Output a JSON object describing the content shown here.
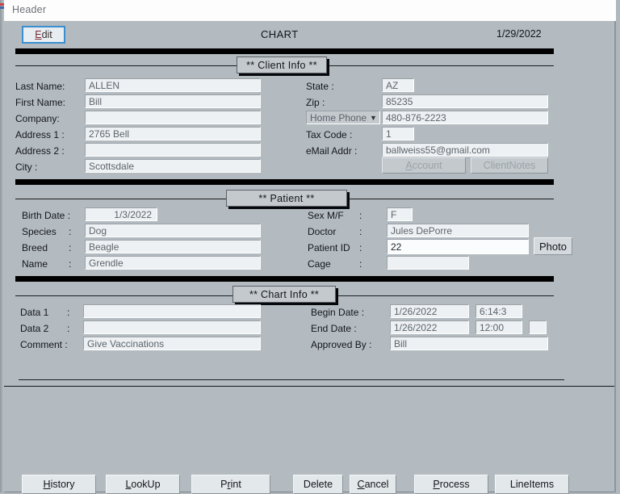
{
  "window": {
    "title": "Header"
  },
  "toolbar": {
    "edit_label": "Edit",
    "edit_accel": "E",
    "chart_title": "CHART",
    "date": "1/29/2022"
  },
  "sections": {
    "client": {
      "chip": "**  Client Info  **"
    },
    "patient": {
      "chip": "**  Patient  **"
    },
    "chartinfo": {
      "chip": "**  Chart Info  **"
    }
  },
  "client": {
    "fields_left": [
      {
        "label": "Last Name:",
        "value": "ALLEN"
      },
      {
        "label": "First Name:",
        "value": "Bill"
      },
      {
        "label": "Company:",
        "value": ""
      },
      {
        "label": "Address 1 :",
        "value": "2765 Bell"
      },
      {
        "label": "Address 2 :",
        "value": ""
      },
      {
        "label": "City :",
        "value": "Scottsdale"
      }
    ],
    "state_label": "State :",
    "state_value": "AZ",
    "zip_label": "Zip :",
    "zip_value": "85235",
    "phone_type": "Home Phone",
    "phone_value": "480-876-2223",
    "tax_label": "Tax Code :",
    "tax_value": "1",
    "email_label": "eMail Addr :",
    "email_value": "ballweiss55@gmail.com",
    "account_label": "Account",
    "account_accel": "A",
    "clientnotes_label": "ClientNotes"
  },
  "patient": {
    "birth_label": "Birth Date :",
    "birth_value": "1/3/2022",
    "species_label": "Species",
    "species_value": "Dog",
    "breed_label": "Breed",
    "breed_value": "Beagle",
    "name_label": "Name",
    "name_value": "Grendle",
    "colon": ":",
    "sex_label": "Sex M/F",
    "sex_value": "F",
    "doctor_label": "Doctor",
    "doctor_value": "Jules DePorre",
    "patientid_label": "Patient ID",
    "patientid_value": "22",
    "cage_label": "Cage",
    "cage_value": "",
    "photo_label": "Photo"
  },
  "chartinfo": {
    "data1_label": "Data 1",
    "data1_value": "",
    "data2_label": "Data 2",
    "data2_value": "",
    "comment_label": "Comment :",
    "comment_value": "Give Vaccinations",
    "colon": ":",
    "begin_label": "Begin Date :",
    "begin_date": "1/26/2022",
    "begin_time": "6:14:3",
    "end_label": "End Date :",
    "end_date": "1/26/2022",
    "end_time": "12:00",
    "end_extra": "",
    "approved_label": "Approved By :",
    "approved_value": "Bill"
  },
  "footer": {
    "buttons": [
      {
        "label": "History",
        "accel": "H"
      },
      {
        "label": "LookUp",
        "accel": "L"
      },
      {
        "label": "Print",
        "accel": "r"
      },
      {
        "label": "Delete",
        "accel": ""
      },
      {
        "label": "Cancel",
        "accel": "C"
      },
      {
        "label": "Process",
        "accel": "P"
      },
      {
        "label": "LineItems",
        "accel": ""
      }
    ]
  },
  "icons": {
    "chevron_down": "chevron-down-icon"
  }
}
